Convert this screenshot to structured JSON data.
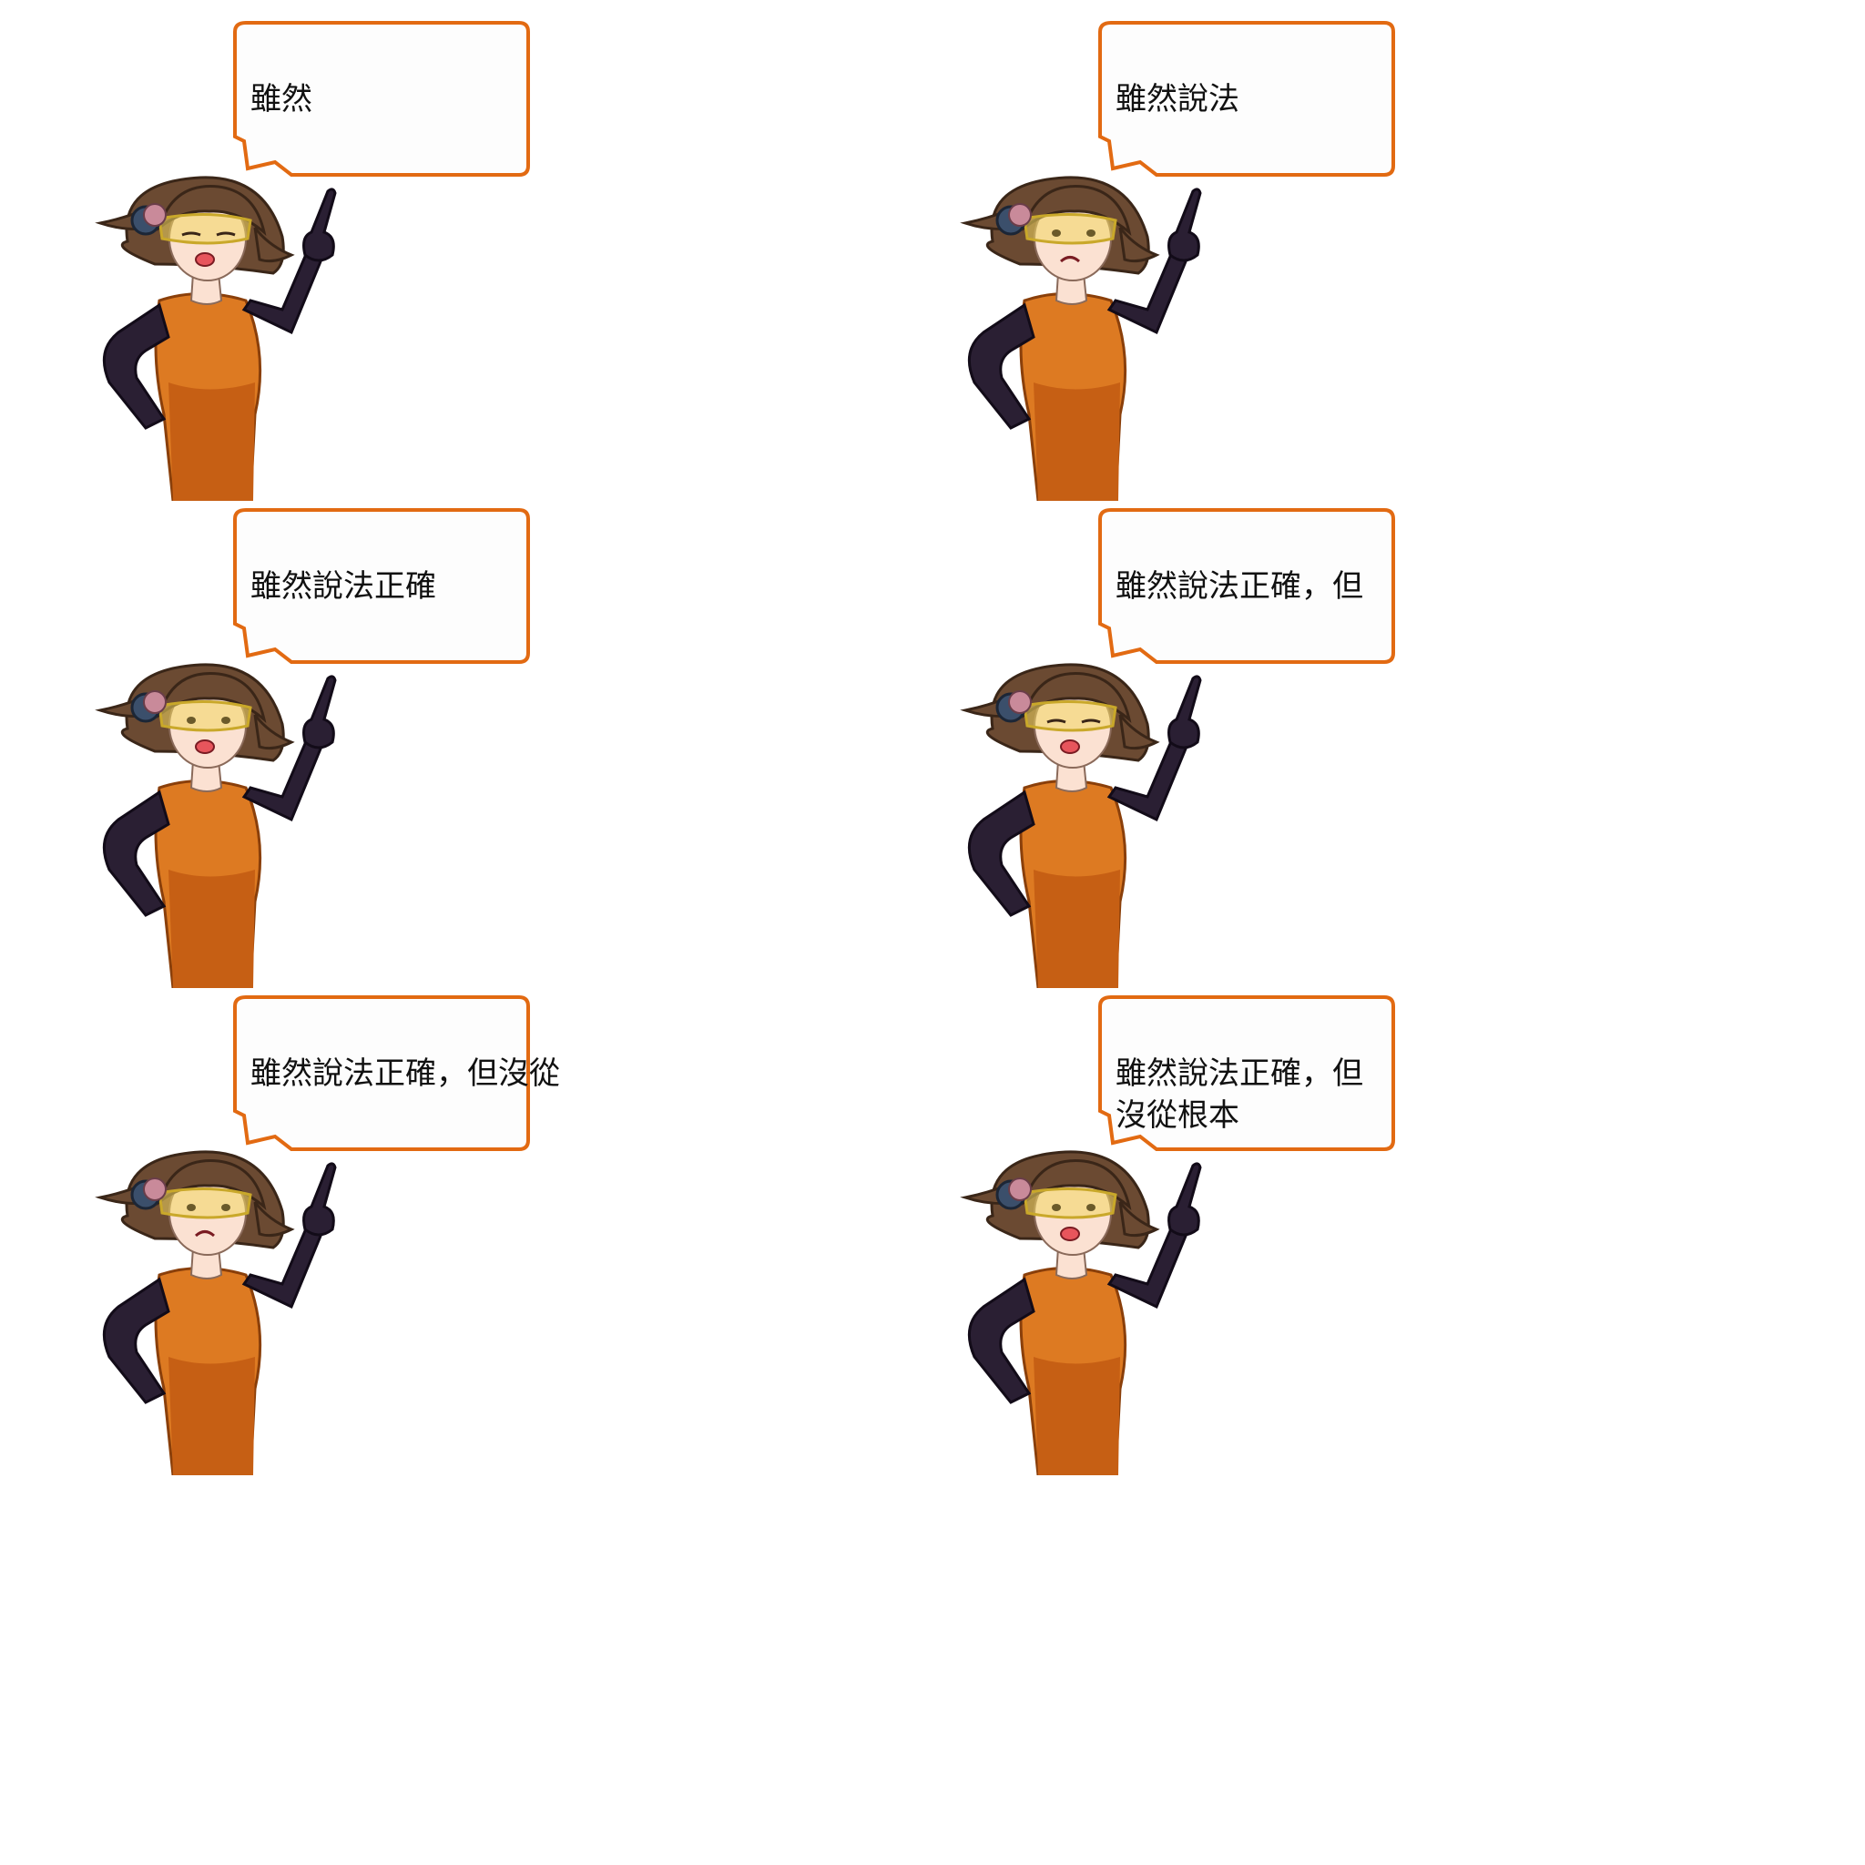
{
  "frames": [
    {
      "text": "雖然",
      "expression": "eyes-closed-talking"
    },
    {
      "text": "雖然說法",
      "expression": "frowning"
    },
    {
      "text": "雖然說法正確",
      "expression": "talking"
    },
    {
      "text": "雖然說法正確，但",
      "expression": "eyes-closed-talking"
    },
    {
      "text": "雖然說法正確，但沒從",
      "expression": "frowning"
    },
    {
      "text": "雖然說法正確，但沒從根本",
      "expression": "talking"
    }
  ],
  "colors": {
    "bubble_border": "#e26a12",
    "bubble_fill": "#fdfdfd",
    "hair": "#6b4a32",
    "dress": "#dd7a22",
    "glove": "#2a1f33",
    "skin": "#fbe1d2",
    "goggles": "#f2d760",
    "headset": "#3b4f6b"
  }
}
